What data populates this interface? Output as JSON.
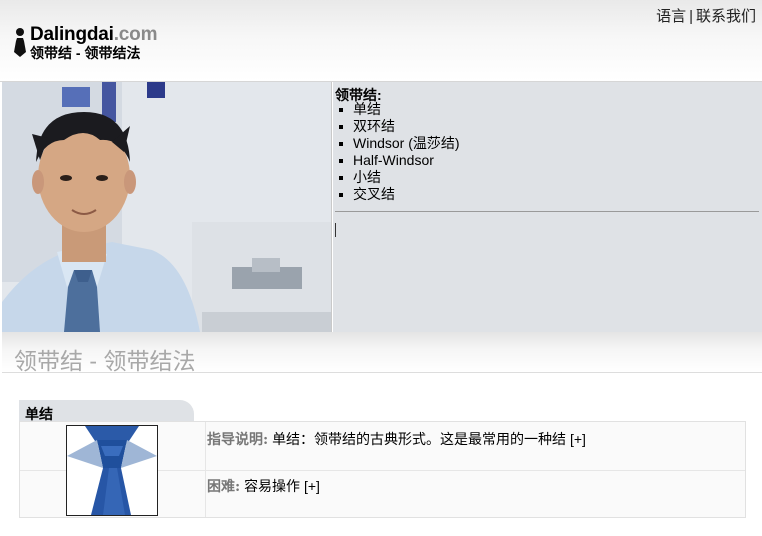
{
  "header": {
    "brand_main": "Dalingdai",
    "brand_domain": ".com",
    "tagline": "领带结 - 领带结法",
    "links": {
      "language": "语言",
      "separator": "|",
      "contact": "联系我们"
    }
  },
  "menu": {
    "title": "领带结:",
    "items": [
      "单结",
      "双环结",
      "Windsor (温莎结)",
      "Half-Windsor",
      "小结",
      "交叉结"
    ]
  },
  "section": {
    "title": "领带结 - 领带结法"
  },
  "knot": {
    "tab_label": "单结",
    "rows": [
      {
        "label": "指导说明:",
        "text": "单结：领带结的古典形式。这是最常用的一种结",
        "more": "[+]"
      },
      {
        "label": "困难:",
        "text": "容易操作",
        "more": "[+]"
      }
    ]
  },
  "colors": {
    "panel": "#dfe2e6",
    "tie_blue": "#1f4f9c",
    "muted_heading": "#a8a8a8"
  }
}
